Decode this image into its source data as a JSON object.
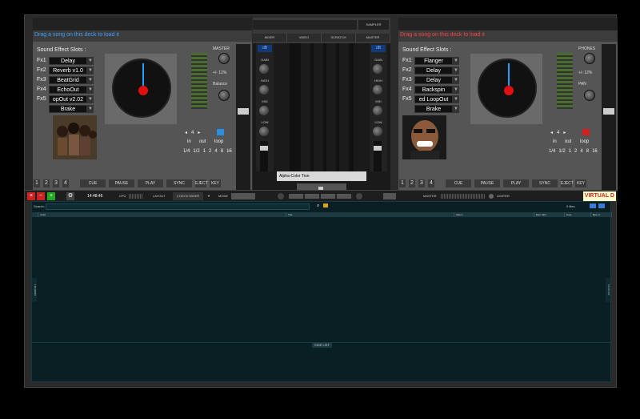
{
  "deck_left": {
    "message": "Drag a song on this deck to load it",
    "fx_header": "Sound Effect Slots :",
    "fx": [
      {
        "label": "Fx1",
        "value": "Delay"
      },
      {
        "label": "Fx2",
        "value": "Reverb v1.0"
      },
      {
        "label": "Fx3",
        "value": "BeatGrid"
      },
      {
        "label": "Fx4",
        "value": "EchoOut"
      },
      {
        "label": "Fx5",
        "value": "opOut v2.02"
      },
      {
        "label": "",
        "value": "Brake"
      }
    ],
    "master_label": "MASTER",
    "pitch_label": "+/- 12%",
    "balance_label": "Balance",
    "loop_in": "in",
    "loop_out": "out",
    "loop_label": "loop",
    "loop_sizes": [
      "1/4",
      "1/2",
      "1",
      "2",
      "4",
      "8",
      "16"
    ],
    "buttons": {
      "n1": "1",
      "n2": "2",
      "n3": "3",
      "n4": "4",
      "cue": "CUE",
      "pause": "PAUSE",
      "play": "PLAY",
      "sync": "SYNC",
      "eject": "EJECT",
      "key": "KEY"
    }
  },
  "deck_right": {
    "message": "Drag a song on this deck to load it",
    "fx_header": "Sound Effect Slots :",
    "fx": [
      {
        "label": "Fx1",
        "value": "Flanger"
      },
      {
        "label": "Fx2",
        "value": "Delay"
      },
      {
        "label": "Fx3",
        "value": "Delay"
      },
      {
        "label": "Fx4",
        "value": "Backspin"
      },
      {
        "label": "Fx5",
        "value": "ed LoopOut"
      },
      {
        "label": "",
        "value": "Brake"
      }
    ],
    "phones_label": "PHONES",
    "pitch_label": "+/- 12%",
    "pan_label": "PAN",
    "loop_in": "in",
    "loop_out": "out",
    "loop_label": "loop",
    "loop_sizes": [
      "1/4",
      "1/2",
      "1",
      "2",
      "4",
      "8",
      "16"
    ],
    "buttons": {
      "n1": "1",
      "n2": "2",
      "n3": "3",
      "n4": "4",
      "cue": "CUE",
      "pause": "PAUSE",
      "play": "PLAY",
      "sync": "SYNC",
      "eject": "EJECT",
      "key": "KEY"
    }
  },
  "mixer": {
    "tabs": [
      "MIXER",
      "VIDEO",
      "SCRATCH",
      "MASTER"
    ],
    "sampler": "SAMPLER",
    "channel_labels": {
      "db": "dB",
      "gain": "GAIN",
      "high": "HIGH",
      "mid": "MID",
      "low": "LOW"
    },
    "video_fx": "Alpha-Color Trsn"
  },
  "statusbar": {
    "time": "14:48:46",
    "cpu": "CPU",
    "layout": "LAYOUT",
    "layout_value": "2 DECK MIXER",
    "mode": "MODE",
    "master": "MASTER",
    "limiter": "LIMITER",
    "brand": "VIRTUAL D"
  },
  "browser": {
    "search_label": "Search:",
    "search_value": "",
    "file_count": "0 files",
    "columns": [
      "Artist",
      "Title",
      "Album",
      "Bpm KEY",
      "Note",
      "Bpm C"
    ],
    "folders_tab": "FOLDERS",
    "playlist_tab": "PLAYLIST",
    "side_list": "SIDE LIST"
  }
}
